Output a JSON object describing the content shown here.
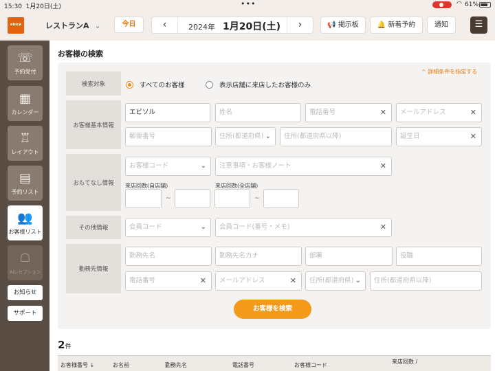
{
  "status": {
    "time": "15:30",
    "date": "1月20日(土)",
    "dots": "•••",
    "battery": "61%"
  },
  "header": {
    "logo": "ebica",
    "restaurant": "レストランA",
    "restaurant_chevron": "⌄",
    "today": "今日",
    "prev": "‹",
    "next": "›",
    "year": "2024年",
    "month_day": "1月20日(土)",
    "board": "掲示板",
    "new_reservations": "新着予約",
    "notice": "通知",
    "menu_icon": "menu-icon"
  },
  "sidebar": {
    "items": [
      {
        "label": "予約受付",
        "icon": "☏"
      },
      {
        "label": "カレンダー",
        "icon": "▦"
      },
      {
        "label": "レイアウト",
        "icon": "♖"
      },
      {
        "label": "予約リスト",
        "icon": "▤"
      },
      {
        "label": "お客様リスト",
        "icon": "👥"
      },
      {
        "label": "AIレセプション",
        "icon": "☖"
      }
    ],
    "info": "お知らせ",
    "support": "サポート"
  },
  "main": {
    "title": "お客様の検索",
    "advanced_link": "^ 詳細条件を指定する",
    "labels": {
      "target": "検索対象",
      "basic": "お客様基本情報",
      "hospitality": "おもてなし情報",
      "other": "その他情報",
      "work": "勤務先情報"
    },
    "target_options": {
      "all": "すべてのお客様",
      "visited": "表示店舗に来店したお客様のみ"
    },
    "basic": {
      "surname_value": "エビソル",
      "name_ph": "姓名",
      "phone_ph": "電話番号",
      "email_ph": "メールアドレス",
      "postal_ph": "郵便番号",
      "pref_ph": "住所(都道府県)",
      "address_ph": "住所(都道府県以降)",
      "birthday_ph": "誕生日"
    },
    "hospitality": {
      "code_ph": "お客様コード",
      "note_ph": "注意事項・お客様ノート",
      "visits_self_label": "来店回数(自店舗)",
      "visits_all_label": "来店回数(全店舗)",
      "tilde": "~"
    },
    "other": {
      "member_ph": "会員コード",
      "member_no_ph": "会員コード(番号・メモ)"
    },
    "work": {
      "company_ph": "勤務先名",
      "company_kana_ph": "勤務先名カナ",
      "dept_ph": "部署",
      "title_ph": "役職",
      "phone_ph": "電話番号",
      "email_ph": "メールアドレス",
      "pref_ph": "住所(都道府県)",
      "address_ph": "住所(都道府県以降)"
    },
    "search_button": "お客様を検索",
    "result_count": "2",
    "result_unit": "件",
    "table_headers": [
      "お客様番号 ↓",
      "お名前",
      "勤務先名",
      "電話番号",
      "お客様コード",
      "来店回数 /"
    ]
  },
  "colors": {
    "accent": "#f39a1b",
    "sidebar": "#5a4d43",
    "active_icon": "#f08a19"
  }
}
